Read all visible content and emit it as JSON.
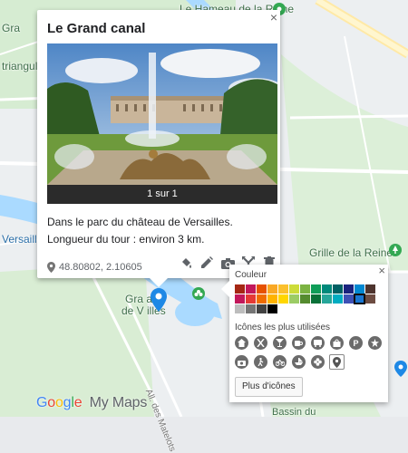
{
  "map": {
    "labels": {
      "top_center": "Le Hameau de la Reine",
      "top_left": "Gra",
      "mid_left": "triangula",
      "lower_left": "Versailles",
      "right_mid": "Grille de la Reine",
      "gardens": "Gra      aux",
      "gardens2": "de V      illes",
      "road": "All. des Matelots",
      "bottom_right": "Bassin du"
    },
    "brand_google": [
      "G",
      "o",
      "o",
      "g",
      "l",
      "e"
    ],
    "brand_suffix": "My Maps"
  },
  "info": {
    "title": "Le Grand canal",
    "close": "×",
    "photo_counter": "1 sur 1",
    "description": "Dans le parc du château de Versailles. Longueur du tour : environ 3 km.",
    "coordinates": "48.80802, 2.10605",
    "tools": [
      "paint-bucket-icon",
      "pencil-icon",
      "camera-icon",
      "directions-icon",
      "trash-icon"
    ]
  },
  "palette": {
    "close": "×",
    "color_label": "Couleur",
    "colors": [
      "#a52714",
      "#c2185b",
      "#e65100",
      "#f9a825",
      "#fbc02d",
      "#cddc39",
      "#7cb342",
      "#0f9d58",
      "#00897b",
      "#006064",
      "#1a237e",
      "#0288d1",
      "#4e342e",
      "#c2185b",
      "#e53935",
      "#ef6c00",
      "#ffb300",
      "#ffd600",
      "#9ccc65",
      "#558b2f",
      "#097138",
      "#26a69a",
      "#00acc1",
      "#3f51b5",
      "#1976d2",
      "#6d4c41",
      "#bdbdbd",
      "#757575",
      "#424242",
      "#000000"
    ],
    "selected_color_index": 24,
    "icons_label": "Icônes les plus utilisées",
    "icons": [
      "home-icon",
      "restaurant-icon",
      "bar-icon",
      "cafe-icon",
      "transit-icon",
      "shopping-icon",
      "parking-icon",
      "star-icon",
      "camera-icon",
      "hiking-icon",
      "bike-icon",
      "boat-icon",
      "flower-icon",
      "pin-icon"
    ],
    "selected_icon_index": 13,
    "more_button": "Plus d'icônes"
  }
}
